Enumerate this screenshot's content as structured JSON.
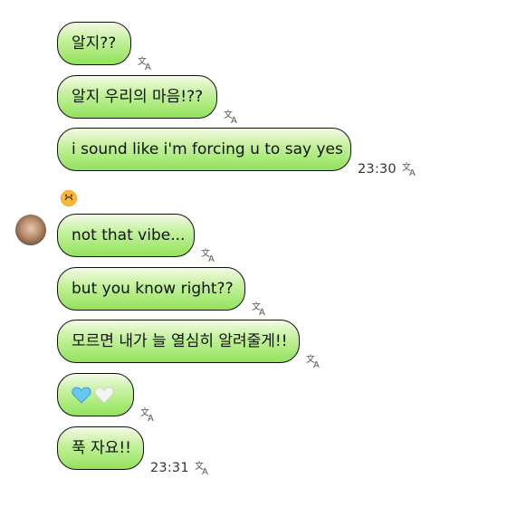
{
  "messages": [
    {
      "text": "알지??",
      "time": ""
    },
    {
      "text": "알지 우리의 마음!??",
      "time": ""
    },
    {
      "text": "i sound like i'm forcing u to say yes",
      "time": "23:30"
    },
    {
      "text": "not that vibe...",
      "time": ""
    },
    {
      "text": "but you know right??",
      "time": ""
    },
    {
      "text": "모르면 내가 늘 열심히 알려줄게!!",
      "time": ""
    },
    {
      "text": "",
      "time": "",
      "emojis": [
        "blue-heart",
        "white-heart"
      ]
    },
    {
      "text": "푹 자요!!",
      "time": "23:31"
    }
  ],
  "reaction": "upside-down-face",
  "colors": {
    "bubble_top": "#f3fbe6",
    "bubble_mid": "#c4f19c",
    "bubble_bottom": "#93e25d",
    "border": "#111111",
    "background": "#ffffff"
  }
}
